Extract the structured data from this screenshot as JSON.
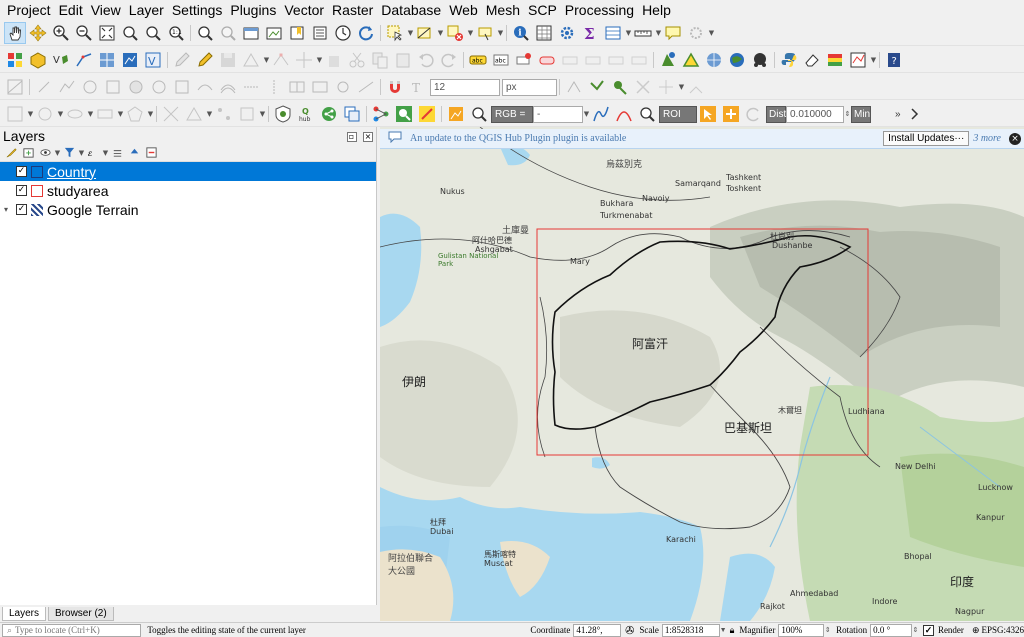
{
  "menu": [
    "Project",
    "Edit",
    "View",
    "Layer",
    "Settings",
    "Plugins",
    "Vector",
    "Raster",
    "Database",
    "Web",
    "Mesh",
    "SCP",
    "Processing",
    "Help"
  ],
  "toolbar": {
    "font_size_value": "12",
    "font_unit": "px",
    "rgb_label": "RGB =",
    "rgb_select": "-",
    "roi_label": "ROI",
    "dist_label": "Dist",
    "dist_value": "0.010000",
    "min_label": "Min",
    "hub_label": "hub"
  },
  "layers_panel": {
    "title": "Layers",
    "layers": [
      {
        "name": "Country",
        "checked": true,
        "selected": true
      },
      {
        "name": "studyarea",
        "checked": true,
        "selected": false
      },
      {
        "name": "Google Terrain",
        "checked": true,
        "selected": false
      }
    ],
    "tabs": [
      "Layers",
      "Browser (2)"
    ]
  },
  "update_bar": {
    "message": "An update to the QGIS Hub Plugin plugin is available",
    "install_label": "Install Updates···",
    "more_label": "3 more"
  },
  "map_labels": [
    {
      "text": "烏茲別克",
      "cls": "med"
    },
    {
      "text": "Samarqand",
      "cls": ""
    },
    {
      "text": "Tashkent",
      "cls": ""
    },
    {
      "text": "Toshkent",
      "cls": ""
    },
    {
      "text": "Navoiy",
      "cls": ""
    },
    {
      "text": "Bukhara",
      "cls": ""
    },
    {
      "text": "土庫曼",
      "cls": "med"
    },
    {
      "text": "阿什哈巴德",
      "cls": ""
    },
    {
      "text": "Ashgabat",
      "cls": ""
    },
    {
      "text": "Mary",
      "cls": ""
    },
    {
      "text": "Nukus",
      "cls": ""
    },
    {
      "text": "Turkmenabat",
      "cls": ""
    },
    {
      "text": "Gulistan National Park",
      "cls": ""
    },
    {
      "text": "阿富汗",
      "cls": "big"
    },
    {
      "text": "伊朗",
      "cls": "big"
    },
    {
      "text": "巴基斯坦",
      "cls": "big"
    },
    {
      "text": "印度",
      "cls": "big"
    },
    {
      "text": "New Delhi",
      "cls": ""
    },
    {
      "text": "Lucknow",
      "cls": ""
    },
    {
      "text": "Kanpur",
      "cls": ""
    },
    {
      "text": "Bhopal",
      "cls": ""
    },
    {
      "text": "Nagpur",
      "cls": ""
    },
    {
      "text": "Indore",
      "cls": ""
    },
    {
      "text": "Ahmedabad",
      "cls": ""
    },
    {
      "text": "Rajkot",
      "cls": ""
    },
    {
      "text": "Ludhiana",
      "cls": ""
    },
    {
      "text": "Karachi",
      "cls": ""
    },
    {
      "text": "阿拉伯聯合大公國",
      "cls": "med"
    },
    {
      "text": "馬斯喀特",
      "cls": ""
    },
    {
      "text": "Muscat",
      "cls": ""
    },
    {
      "text": "杜拜",
      "cls": ""
    },
    {
      "text": "Dubai",
      "cls": ""
    },
    {
      "text": "木爾坦",
      "cls": ""
    },
    {
      "text": "杜尚別",
      "cls": ""
    },
    {
      "text": "Dushanbe",
      "cls": ""
    }
  ],
  "status": {
    "locator_placeholder": "Type to locate (Ctrl+K)",
    "message": "Toggles the editing state of the current layer",
    "coordinate_label": "Coordinate",
    "coordinate_value": "41.28°, 82.44°",
    "scale_label": "Scale",
    "scale_value": "1:8528318",
    "magnifier_label": "Magnifier",
    "magnifier_value": "100%",
    "rotation_label": "Rotation",
    "rotation_value": "0.0 °",
    "render_label": "Render",
    "crs_label": "EPSG:4326"
  },
  "colors": {
    "selection": "#0078d7",
    "study_area": "#e53935",
    "water": "#a8d8f0",
    "land": "#e6e8de"
  }
}
